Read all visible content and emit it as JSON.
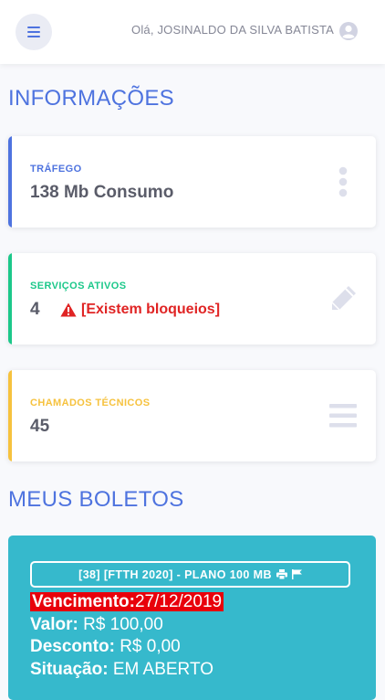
{
  "header": {
    "greeting": "Olá, JOSINALDO DA SILVA BATISTA"
  },
  "sections": {
    "info_title": "INFORMAÇÕES",
    "boletos_title": "MEUS BOLETOS"
  },
  "cards": {
    "trafego": {
      "label": "TRÁFEGO",
      "value": "138 Mb Consumo",
      "accent": "#4e73df"
    },
    "servicos": {
      "label": "SERVIÇOS ATIVOS",
      "value": "4",
      "warning": "[Existem bloqueios]",
      "accent": "#1cc88a"
    },
    "chamados": {
      "label": "CHAMADOS TÉCNICOS",
      "value": "45",
      "accent": "#f6c23e"
    }
  },
  "boleto": {
    "plan": "[38] [FTTH 2020] - PLANO 100 MB",
    "vencimento_label": "Vencimento:",
    "vencimento_value": "27/12/2019",
    "valor_label": "Valor:",
    "valor_value": "R$ 100,00",
    "desconto_label": "Desconto:",
    "desconto_value": "R$ 0,00",
    "situacao_label": "Situação:",
    "situacao_value": "EM ABERTO",
    "color": "#36b9cc"
  },
  "icons": {
    "menu": "hamburger-icon",
    "avatar": "user-circle-icon",
    "more": "ellipsis-vertical-icon",
    "edit": "pencil-icon",
    "list": "bars-icon",
    "warning": "warning-triangle-icon",
    "print": "printer-icon",
    "flag": "flag-icon"
  }
}
